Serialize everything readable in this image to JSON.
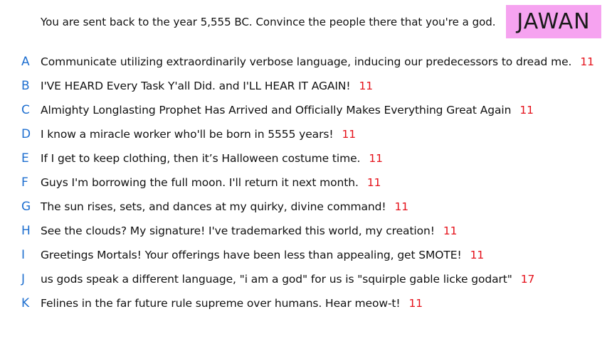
{
  "prompt": "You are sent back to the year 5,555 BC. Convince the people there that you're a god.",
  "player_name": "JAWAN",
  "colors": {
    "badge": "#f6a3f0",
    "letter": "#1e6fd0",
    "score": "#e5121b"
  },
  "answers": [
    {
      "letter": "A",
      "text": "Communicate utilizing extraordinarily verbose language, inducing our predecessors to dread me.",
      "score": "11"
    },
    {
      "letter": "B",
      "text": "I'VE HEARD Every Task Y'all Did. and I'LL HEAR IT AGAIN!",
      "score": "11"
    },
    {
      "letter": "C",
      "text": "Almighty Longlasting Prophet Has Arrived and Officially Makes Everything Great Again",
      "score": "11"
    },
    {
      "letter": "D",
      "text": "I know a miracle worker who'll be born in 5555 years!",
      "score": "11"
    },
    {
      "letter": "E",
      "text": "If I get to keep clothing, then it’s Halloween costume time.",
      "score": "11"
    },
    {
      "letter": "F",
      "text": "Guys I'm borrowing the full moon. I'll return it next month.",
      "score": "11"
    },
    {
      "letter": "G",
      "text": "The sun rises, sets, and dances at my quirky, divine command!",
      "score": "11"
    },
    {
      "letter": "H",
      "text": "See the clouds? My signature! I've trademarked this world, my creation!",
      "score": "11"
    },
    {
      "letter": "I",
      "text": "Greetings Mortals! Your offerings have been less than appealing, get SMOTE!",
      "score": "11"
    },
    {
      "letter": "J",
      "text": "us gods speak a different language, \"i am a god\" for us is \"squirple gable licke godart\"",
      "score": "17"
    },
    {
      "letter": "K",
      "text": "Felines in the far future rule supreme over humans. Hear meow-t!",
      "score": "11"
    }
  ]
}
